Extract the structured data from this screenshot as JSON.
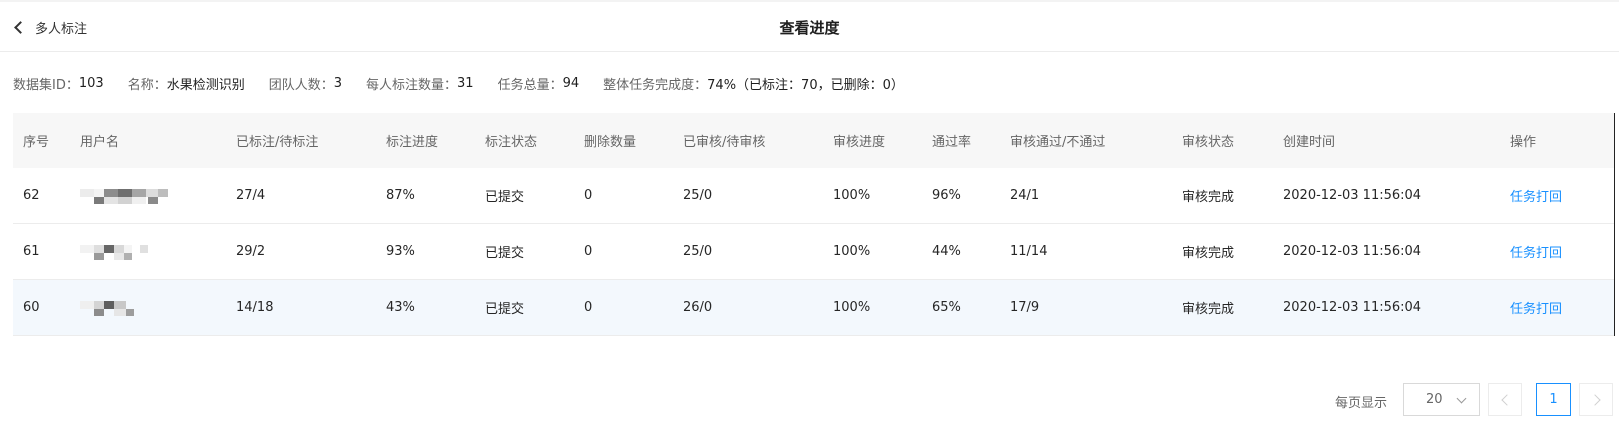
{
  "header": {
    "back_label": "多人标注",
    "title": "查看进度"
  },
  "info": [
    {
      "key": "数据集ID：",
      "value": "103"
    },
    {
      "key": "名称：",
      "value": "水果检测识别"
    },
    {
      "key": "团队人数：",
      "value": "3"
    },
    {
      "key": "每人标注数量：",
      "value": "31"
    },
    {
      "key": "任务总量：",
      "value": "94"
    },
    {
      "key": "整体任务完成度：",
      "value": "74%（已标注：70，已删除：0）"
    }
  ],
  "table": {
    "columns": [
      "序号",
      "用户名",
      "已标注/待标注",
      "标注进度",
      "标注状态",
      "删除数量",
      "已审核/待审核",
      "审核进度",
      "通过率",
      "审核通过/不通过",
      "审核状态",
      "创建时间",
      "操作"
    ],
    "rows": [
      {
        "id": "62",
        "labeled": "27/4",
        "progress": "87%",
        "status": "已提交",
        "deleted": "0",
        "reviewed": "25/0",
        "review_progress": "100%",
        "pass_rate": "96%",
        "pass_fail": "24/1",
        "review_status": "审核完成",
        "created": "2020-12-03 11:56:04",
        "action": "任务打回"
      },
      {
        "id": "61",
        "labeled": "29/2",
        "progress": "93%",
        "status": "已提交",
        "deleted": "0",
        "reviewed": "25/0",
        "review_progress": "100%",
        "pass_rate": "44%",
        "pass_fail": "11/14",
        "review_status": "审核完成",
        "created": "2020-12-03 11:56:04",
        "action": "任务打回"
      },
      {
        "id": "60",
        "labeled": "14/18",
        "progress": "43%",
        "status": "已提交",
        "deleted": "0",
        "reviewed": "26/0",
        "review_progress": "100%",
        "pass_rate": "65%",
        "pass_fail": "17/9",
        "review_status": "审核完成",
        "created": "2020-12-03 11:56:04",
        "action": "任务打回"
      }
    ]
  },
  "pagination": {
    "per_page_label": "每页显示",
    "per_page_value": "20",
    "current_page": "1"
  },
  "colors": {
    "accent": "#1890ff",
    "highlight_row": "#f3f8fd",
    "header_bg": "#f7f7f7"
  },
  "icons": [
    "chevron-left-icon",
    "chevron-down-icon",
    "chevron-right-icon"
  ]
}
